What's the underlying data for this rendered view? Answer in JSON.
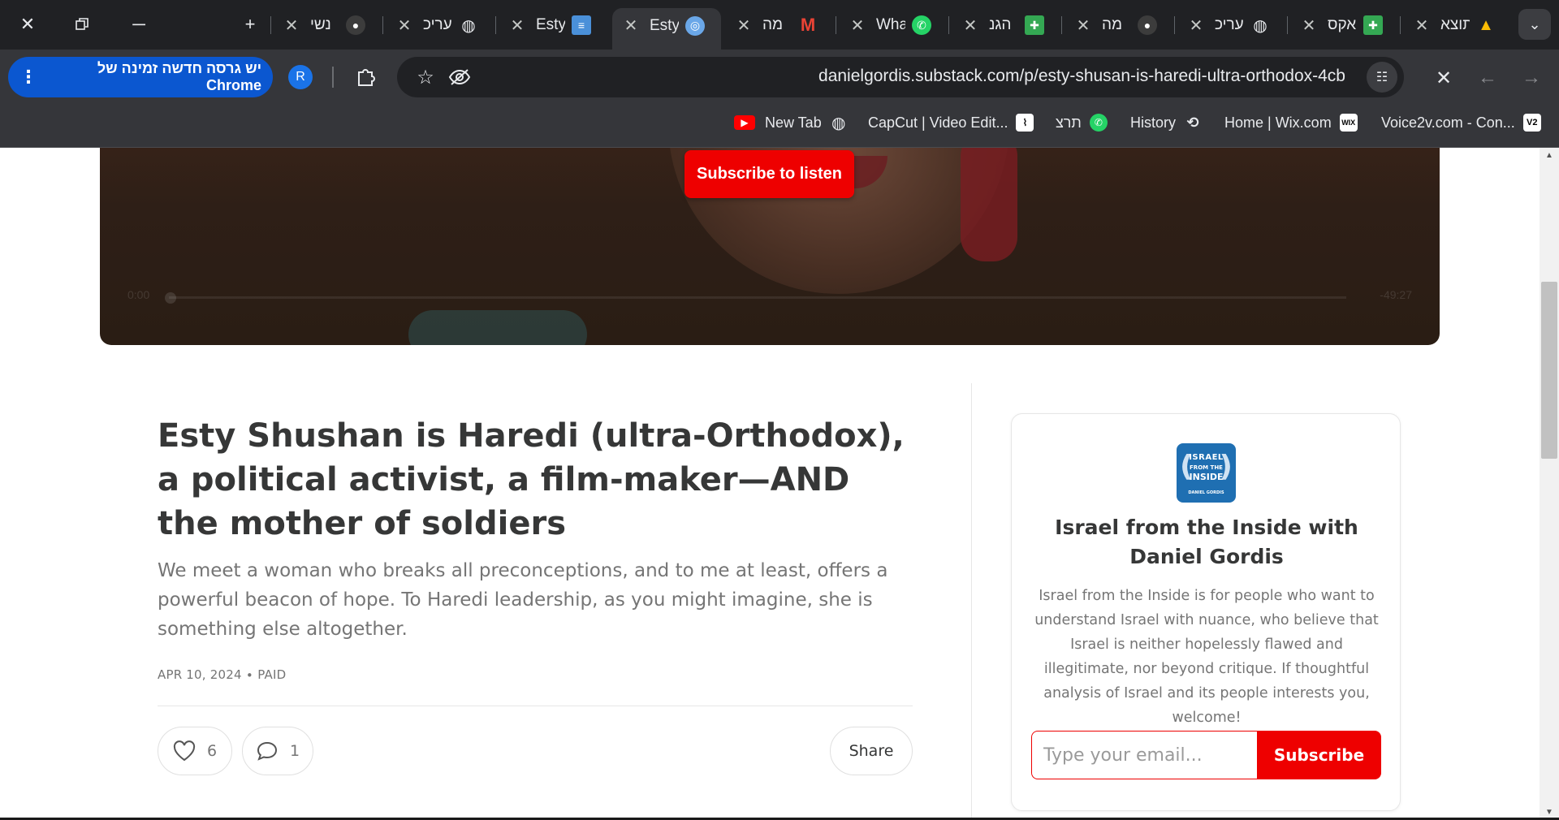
{
  "browser": {
    "tabs": [
      {
        "title": "נשי",
        "icon": "avatar-icon",
        "icon_color": "#3c3c3c",
        "active": false
      },
      {
        "title": "עריכ",
        "icon": "globe-icon",
        "icon_color": "#e8eaed",
        "active": false
      },
      {
        "title": "Esty",
        "icon": "docs-icon",
        "icon_color": "#4a90d9",
        "active": false
      },
      {
        "title": "Esty",
        "icon": "substack-icon",
        "icon_color": "#6aa7e8",
        "active": true
      },
      {
        "title": "מה",
        "icon": "gmail-icon",
        "icon_color": "#ea4335",
        "active": false
      },
      {
        "title": "Wha",
        "icon": "whatsapp-icon",
        "icon_color": "#25d366",
        "active": false
      },
      {
        "title": "הגנ",
        "icon": "sheets-icon",
        "icon_color": "#34a853",
        "active": false
      },
      {
        "title": "מה",
        "icon": "avatar-icon",
        "icon_color": "#3c3c3c",
        "active": false
      },
      {
        "title": "עריכ",
        "icon": "globe-icon",
        "icon_color": "#e8eaed",
        "active": false
      },
      {
        "title": "אקס",
        "icon": "sheets-icon",
        "icon_color": "#34a853",
        "active": false
      },
      {
        "title": "תוצא",
        "icon": "drive-icon",
        "icon_color": "#fbbc04",
        "active": false
      }
    ],
    "update_text": "יש גרסה חדשה זמינה של Chrome",
    "profile_initial": "R",
    "url": "danielgordis.substack.com/p/esty-shusan-is-haredi-ultra-orthodox-4cb",
    "bookmarks": [
      {
        "label": "",
        "icon": "youtube-icon"
      },
      {
        "label": "New Tab",
        "icon": "globe-icon"
      },
      {
        "label": "CapCut | Video Edit...",
        "icon": "capcut-icon"
      },
      {
        "label": "תרצ",
        "icon": "whatsapp-icon"
      },
      {
        "label": "History",
        "icon": "history-icon"
      },
      {
        "label": "Home | Wix.com",
        "icon": "wix-icon"
      },
      {
        "label": "Voice2v.com - Con...",
        "icon": "v2-icon"
      }
    ]
  },
  "player": {
    "subscribe_label": "Subscribe to listen",
    "time_start": "0:00",
    "time_end": "-49:27"
  },
  "post": {
    "title": "Esty Shushan is Haredi (ultra-Orthodox), a political activist, a film-maker—AND the mother of soldiers",
    "subtitle": "We meet a woman who breaks all preconceptions, and to me at least, offers a powerful beacon of hope. To Haredi leadership, as you might imagine, she is something else altogether.",
    "meta": "APR 10, 2024 ∙ PAID",
    "likes": "6",
    "comments": "1",
    "share_label": "Share"
  },
  "sidebar": {
    "logo_lines": [
      "ISRAEL",
      "FROM THE",
      "INSIDE",
      "DANIEL GORDIS"
    ],
    "title": "Israel from the Inside with Daniel Gordis",
    "description": "Israel from the Inside is for people who want to understand Israel with nuance, who believe that Israel is neither hopelessly flawed and illegitimate, nor beyond critique. If thoughtful analysis of Israel and its people interests you, welcome!",
    "email_placeholder": "Type your email...",
    "subscribe_label": "Subscribe"
  },
  "colors": {
    "accent": "#ee0000",
    "text_dark": "#363737",
    "text_muted": "#757575"
  }
}
